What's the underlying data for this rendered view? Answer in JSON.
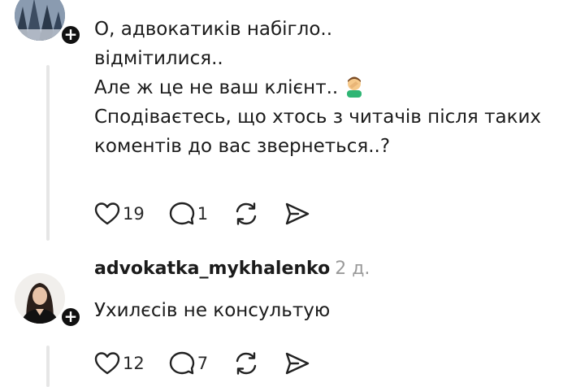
{
  "comment1": {
    "lines": [
      "О, адвокатиків набігло..",
      "відмітилися..",
      "Але ж це не ваш клієнт..",
      "Сподіваєтесь, що хтось з читачів після таких",
      "коментів до вас звернеться..?"
    ],
    "emoji": "facepalm-emoji",
    "likes": "19",
    "replies": "1"
  },
  "comment2": {
    "username": "advokatka_mykhalenko",
    "timestamp": "2 д.",
    "text": "Ухилєсів не консультую",
    "likes": "12",
    "replies": "7"
  },
  "badge_symbol": "+",
  "icons": [
    "heart-icon",
    "comment-icon",
    "repost-icon",
    "share-icon",
    "plus-icon"
  ]
}
